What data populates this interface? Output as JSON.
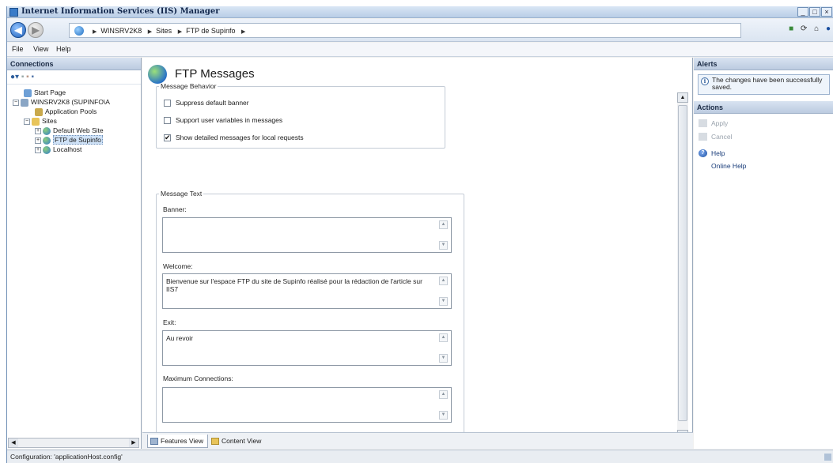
{
  "window": {
    "title": "Internet Information Services (IIS) Manager",
    "buttons": [
      "_",
      "□",
      "×"
    ]
  },
  "nav": {
    "breadcrumbs": [
      "WINSRV2K8",
      "Sites",
      "FTP de Supinfo"
    ],
    "sep": "▶"
  },
  "menu": {
    "items": [
      "File",
      "View",
      "Help"
    ]
  },
  "connections": {
    "header": "Connections",
    "tree": {
      "start_page": "Start Page",
      "server": "WINSRV2K8 (SUPINFO\\A",
      "app_pools": "Application Pools",
      "sites": "Sites",
      "default_site": "Default Web Site",
      "ftp_site": "FTP de Supinfo",
      "localhost": "Localhost"
    }
  },
  "page": {
    "title": "FTP Messages",
    "behavior": {
      "legend": "Message Behavior",
      "suppress_banner": {
        "label": "Suppress default banner",
        "checked": false
      },
      "user_variables": {
        "label": "Support user variables in messages",
        "checked": false
      },
      "detailed_messages": {
        "label": "Show detailed messages for local requests",
        "checked": true
      }
    },
    "message_text": {
      "legend": "Message Text",
      "banner": {
        "label": "Banner:",
        "value": ""
      },
      "welcome": {
        "label": "Welcome:",
        "value": "Bienvenue sur l'espace FTP du site de Supinfo réalisé pour la rédaction de l'article sur IIS7"
      },
      "exit": {
        "label": "Exit:",
        "value": "Au revoir"
      },
      "max_connections": {
        "label": "Maximum Connections:",
        "value": ""
      }
    }
  },
  "view_tabs": {
    "features": "Features View",
    "content": "Content View"
  },
  "alerts": {
    "header": "Alerts",
    "message": "The changes have been successfully saved."
  },
  "actions": {
    "header": "Actions",
    "apply": "Apply",
    "cancel": "Cancel",
    "help": "Help",
    "online_help": "Online Help"
  },
  "status": {
    "text": "Configuration: 'applicationHost.config'"
  },
  "icons": [
    "back-arrow-icon",
    "forward-arrow-icon",
    "globe-icon",
    "info-icon",
    "help-icon",
    "apply-icon",
    "cancel-icon",
    "features-view-icon",
    "content-view-icon"
  ]
}
